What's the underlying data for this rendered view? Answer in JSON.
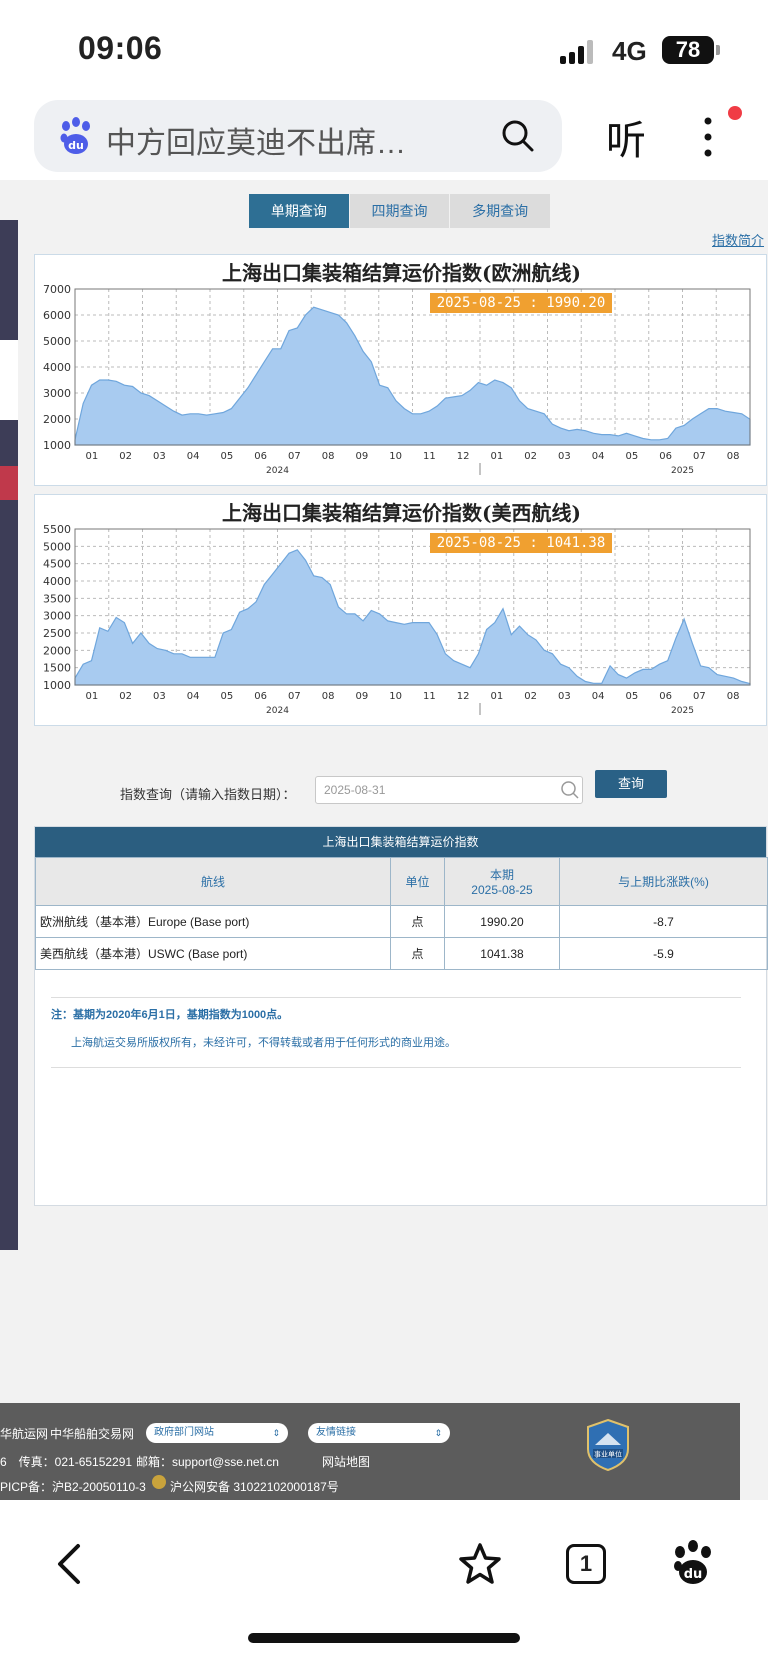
{
  "status_bar": {
    "time": "09:06",
    "network": "4G",
    "battery": "78"
  },
  "browser": {
    "search_text": "中方回应莫迪不出席…",
    "listen_label": "听",
    "tab_count": "1"
  },
  "page": {
    "tabs": [
      {
        "label": "单期查询",
        "active": true
      },
      {
        "label": "四期查询",
        "active": false
      },
      {
        "label": "多期查询",
        "active": false
      }
    ],
    "intro_link": "指数简介",
    "query": {
      "label": "指数查询（请输入指数日期）：",
      "value": "2025-08-31",
      "button": "查询"
    },
    "table": {
      "title": "上海出口集装箱结算运价指数",
      "headers": {
        "route": "航线",
        "unit": "单位",
        "period": "本期",
        "period_date": "2025-08-25",
        "change": "与上期比涨跌(%)"
      },
      "rows": [
        {
          "route": "欧洲航线（基本港）Europe (Base port)",
          "unit": "点",
          "value": "1990.20",
          "change": "-8.7"
        },
        {
          "route": "美西航线（基本港）USWC (Base port)",
          "unit": "点",
          "value": "1041.38",
          "change": "-5.9"
        }
      ]
    },
    "notes": {
      "note1": "注：基期为2020年6月1日，基期指数为1000点。",
      "note2": "上海航运交易所版权所有，未经许可，不得转载或者用于任何形式的商业用途。"
    },
    "footer": {
      "links": [
        "华航运网",
        "中华船舶交易网"
      ],
      "select_gov": "政府部门网站",
      "select_friend": "友情链接",
      "fax": "6　传真：021-65152291",
      "email": "邮箱：support@sse.net.cn",
      "sitemap": "网站地图",
      "icp": "PICP备：沪B2-20050110-3",
      "police": "沪公网安备 31022102000187号",
      "emblem_text": "事业单位"
    }
  },
  "chart_data": [
    {
      "type": "area",
      "title": "上海出口集装箱结算运价指数(欧洲航线)",
      "badge": "2025-08-25 : 1990.20",
      "x_ticks": [
        "01",
        "02",
        "03",
        "04",
        "05",
        "06",
        "07",
        "08",
        "09",
        "10",
        "11",
        "12",
        "01",
        "02",
        "03",
        "04",
        "05",
        "06",
        "07",
        "08"
      ],
      "year_labels": [
        "2024",
        "2025"
      ],
      "ylim": [
        1000,
        7000
      ],
      "y_ticks": [
        1000,
        2000,
        3000,
        4000,
        5000,
        6000,
        7000
      ],
      "color": "#a8cbf0",
      "values": [
        1200,
        2600,
        3300,
        3500,
        3500,
        3450,
        3300,
        3250,
        3000,
        2900,
        2700,
        2500,
        2300,
        2150,
        2200,
        2200,
        2150,
        2200,
        2250,
        2400,
        2800,
        3200,
        3700,
        4200,
        4700,
        4700,
        5400,
        5500,
        6000,
        6300,
        6200,
        6100,
        6000,
        5700,
        5200,
        4600,
        4200,
        3300,
        3200,
        2700,
        2400,
        2200,
        2200,
        2300,
        2500,
        2800,
        2850,
        2900,
        3100,
        3400,
        3300,
        3500,
        3400,
        3200,
        2700,
        2400,
        2300,
        2200,
        1800,
        1650,
        1550,
        1600,
        1550,
        1450,
        1400,
        1400,
        1350,
        1450,
        1350,
        1250,
        1200,
        1200,
        1250,
        1650,
        1750,
        2000,
        2200,
        2400,
        2400,
        2300,
        2250,
        2200,
        1990
      ]
    },
    {
      "type": "area",
      "title": "上海出口集装箱结算运价指数(美西航线)",
      "badge": "2025-08-25 : 1041.38",
      "x_ticks": [
        "01",
        "02",
        "03",
        "04",
        "05",
        "06",
        "07",
        "08",
        "09",
        "10",
        "11",
        "12",
        "01",
        "02",
        "03",
        "04",
        "05",
        "06",
        "07",
        "08"
      ],
      "year_labels": [
        "2024",
        "2025"
      ],
      "ylim": [
        1000,
        5500
      ],
      "y_ticks": [
        1000,
        1500,
        2000,
        2500,
        3000,
        3500,
        4000,
        4500,
        5000,
        5500
      ],
      "color": "#a8cbf0",
      "values": [
        1200,
        1600,
        1700,
        2650,
        2550,
        2950,
        2800,
        2200,
        2500,
        2200,
        2050,
        2000,
        1900,
        1900,
        1800,
        1800,
        1800,
        1800,
        2500,
        2600,
        3100,
        3200,
        3400,
        3900,
        4200,
        4500,
        4800,
        4900,
        4600,
        4150,
        4100,
        3900,
        3250,
        3050,
        3050,
        2850,
        3150,
        3050,
        2850,
        2800,
        2750,
        2800,
        2800,
        2800,
        2450,
        1900,
        1700,
        1600,
        1500,
        1900,
        2600,
        2800,
        3200,
        2450,
        2700,
        2450,
        2300,
        2000,
        1900,
        1600,
        1500,
        1250,
        1100,
        1050,
        1050,
        1550,
        1300,
        1200,
        1350,
        1450,
        1450,
        1600,
        1700,
        2350,
        2900,
        2200,
        1550,
        1500,
        1300,
        1250,
        1200,
        1100,
        1041
      ]
    }
  ]
}
